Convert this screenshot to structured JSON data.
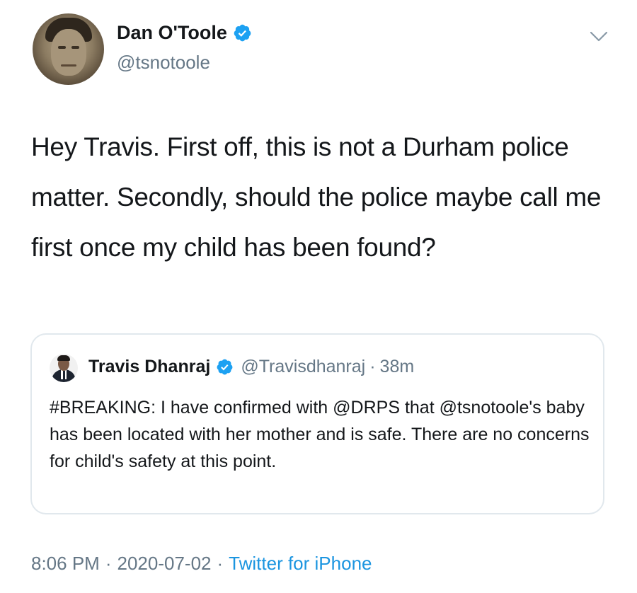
{
  "tweet": {
    "author": {
      "display_name": "Dan O'Toole",
      "handle": "@tsnotoole",
      "verified": true
    },
    "text": "Hey Travis. First off, this is not a Durham police matter. Secondly, should the police maybe call me first once my child has been found?",
    "quoted_tweet": {
      "author": {
        "display_name": "Travis Dhanraj",
        "handle": "@Travisdhanraj",
        "verified": true
      },
      "separator": "·",
      "relative_time": "38m",
      "text": "#BREAKING: I have confirmed with @DRPS that @tsnotoole's baby has been located with her mother and is safe. There are no concerns for child's safety at this point."
    },
    "meta": {
      "time": "8:06 PM",
      "date": "2020-07-02",
      "source": "Twitter for iPhone",
      "separator": "·"
    }
  },
  "icons": {
    "verified": "verified-badge-icon",
    "more": "chevron-down-icon"
  },
  "colors": {
    "text": "#14171a",
    "secondary": "#657786",
    "link": "#1b95e0",
    "verified": "#1da1f2",
    "border": "#e1e8ed"
  }
}
